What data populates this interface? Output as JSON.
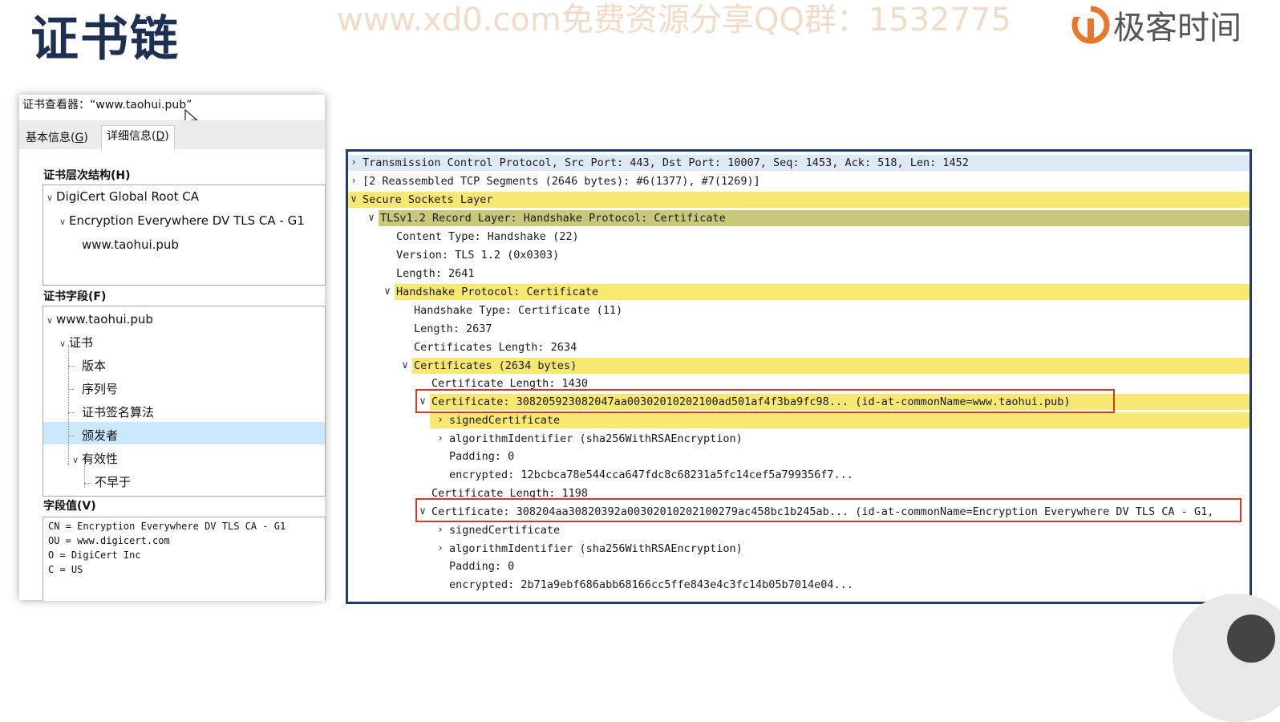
{
  "slide": {
    "title": "证书链",
    "watermark": "www.xd0.com免费资源分享QQ群：1532775",
    "brand": "极客时间"
  },
  "cert_viewer": {
    "title": "证书查看器：“www.taohui.pub”",
    "tabs": [
      {
        "label": "基本信息(",
        "key": "G",
        "end": ")"
      },
      {
        "label": "详细信息(",
        "key": "D",
        "end": ")"
      }
    ],
    "hierarchy_label": "证书层次结构(H)",
    "hierarchy": [
      {
        "label": "DigiCert Global Root CA"
      },
      {
        "label": "Encryption Everywhere DV TLS CA - G1"
      },
      {
        "label": "www.taohui.pub"
      }
    ],
    "fields_label": "证书字段(F)",
    "fields": [
      {
        "label": "www.taohui.pub"
      },
      {
        "label": "证书"
      },
      {
        "label": "版本"
      },
      {
        "label": "序列号"
      },
      {
        "label": "证书签名算法"
      },
      {
        "label": "颁发者"
      },
      {
        "label": "有效性"
      },
      {
        "label": "不早于"
      }
    ],
    "selected_field": "颁发者",
    "value_label": "字段值(V)",
    "value_lines": [
      "CN = Encryption Everywhere DV TLS CA - G1",
      "OU = www.digicert.com",
      "O = DigiCert Inc",
      "C = US"
    ]
  },
  "packet_details": {
    "rows": [
      {
        "text": "Transmission Control Protocol, Src Port: 443, Dst Port: 10007, Seq: 1453, Ack: 518, Len: 1452",
        "toggle": ">",
        "highlight": "blue"
      },
      {
        "text": "[2 Reassembled TCP Segments (2646 bytes): #6(1377), #7(1269)]",
        "toggle": ">",
        "highlight": "none"
      },
      {
        "text": "Secure Sockets Layer",
        "toggle": "v",
        "highlight": "yellow"
      },
      {
        "text": "TLSv1.2 Record Layer: Handshake Protocol: Certificate",
        "toggle": "v",
        "highlight": "olive"
      },
      {
        "text": "Content Type: Handshake (22)",
        "toggle": "",
        "highlight": "none"
      },
      {
        "text": "Version: TLS 1.2 (0x0303)",
        "toggle": "",
        "highlight": "none"
      },
      {
        "text": "Length: 2641",
        "toggle": "",
        "highlight": "none"
      },
      {
        "text": "Handshake Protocol: Certificate",
        "toggle": "v",
        "highlight": "yellow"
      },
      {
        "text": "Handshake Type: Certificate (11)",
        "toggle": "",
        "highlight": "none"
      },
      {
        "text": "Length: 2637",
        "toggle": "",
        "highlight": "none"
      },
      {
        "text": "Certificates Length: 2634",
        "toggle": "",
        "highlight": "none"
      },
      {
        "text": "Certificates (2634 bytes)",
        "toggle": "v",
        "highlight": "yellow"
      },
      {
        "text": "Certificate Length: 1430",
        "toggle": "",
        "highlight": "none"
      },
      {
        "text": "Certificate: 308205923082047aa00302010202100ad501af4f3ba9fc98... (id-at-commonName=www.taohui.pub)",
        "toggle": "v",
        "highlight": "yellow",
        "boxed": true
      },
      {
        "text": "signedCertificate",
        "toggle": ">",
        "highlight": "yellow"
      },
      {
        "text": "algorithmIdentifier (sha256WithRSAEncryption)",
        "toggle": ">",
        "highlight": "none"
      },
      {
        "text": "Padding: 0",
        "toggle": "",
        "highlight": "none"
      },
      {
        "text": "encrypted: 12bcbca78e544cca647fdc8c68231a5fc14cef5a799356f7...",
        "toggle": "",
        "highlight": "none"
      },
      {
        "text": "Certificate Length: 1198",
        "toggle": "",
        "highlight": "none"
      },
      {
        "text": "Certificate: 308204aa30820392a00302010202100279ac458bc1b245ab... (id-at-commonName=Encryption Everywhere DV TLS CA - G1,",
        "toggle": "v",
        "highlight": "none",
        "boxed": true
      },
      {
        "text": "signedCertificate",
        "toggle": ">",
        "highlight": "none"
      },
      {
        "text": "algorithmIdentifier (sha256WithRSAEncryption)",
        "toggle": ">",
        "highlight": "none"
      },
      {
        "text": "Padding: 0",
        "toggle": "",
        "highlight": "none"
      },
      {
        "text": "encrypted: 2b71a9ebf686abb68166cc5ffe843e4c3fc14b05b7014e04...",
        "toggle": "",
        "highlight": "none"
      }
    ]
  },
  "colors": {
    "title": "#1f2f52",
    "highlight_yellow": "#f8e770",
    "highlight_olive": "#c9c87a",
    "highlight_blue": "#dfe9f5",
    "annotation_box": "#d43a2a",
    "panel_border": "#1f3c70",
    "selection": "#cce8ff"
  }
}
